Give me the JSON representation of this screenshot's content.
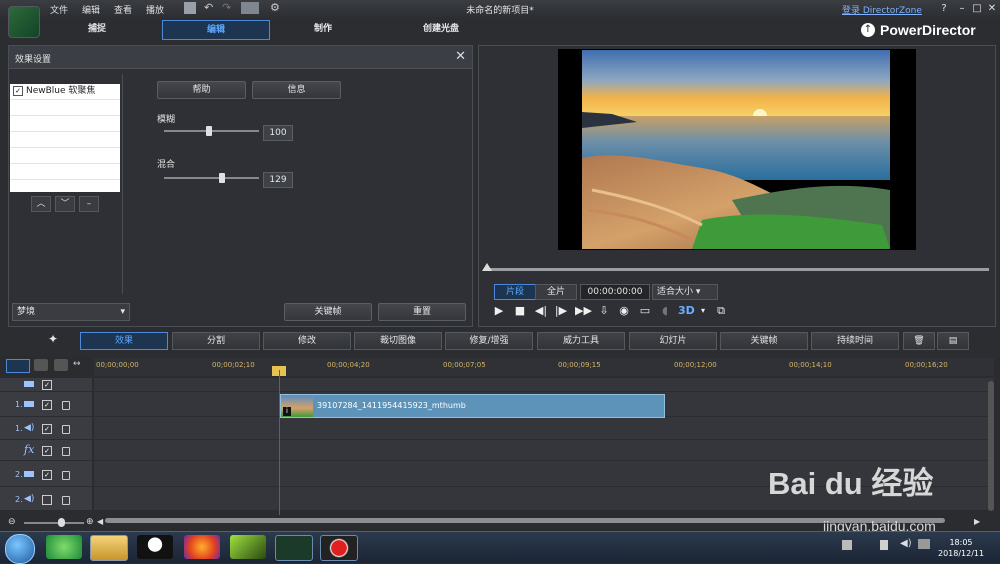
{
  "menu": [
    "文件",
    "编辑",
    "查看",
    "播放"
  ],
  "title": "未命名的新项目*",
  "login": "登录 DirectorZone",
  "modes": [
    "捕捉",
    "编辑",
    "制作",
    "创建光盘"
  ],
  "active_mode": "编辑",
  "brand": "PowerDirector",
  "effect_panel": {
    "title": "效果设置",
    "list_item": "NewBlue 软聚焦",
    "help_label": "帮助",
    "info_label": "信息",
    "blur_label": "模糊",
    "blur_value": "100",
    "mix_label": "混合",
    "mix_value": "129",
    "preset": "梦境",
    "keyframe_label": "关键帧",
    "reset_label": "重置"
  },
  "preview": {
    "segment_label": "片段",
    "full_label": "全片",
    "timecode": "00:00:00:00",
    "fit_label": "适合大小"
  },
  "toolbar": [
    "效果",
    "分割",
    "修改",
    "裁切图像",
    "修复/增强",
    "威力工具",
    "幻灯片",
    "关键帧",
    "持续时间"
  ],
  "timeline": {
    "ticks": [
      "00;00;00;00",
      "00;00;02;10",
      "00;00;04;20",
      "00;00;07;05",
      "00;00;09;15",
      "00;00;12;00",
      "00;00;14;10",
      "00;00;16;20"
    ],
    "clip_name": "39107284_1411954415923_mthumb",
    "track_numbers": [
      "1.",
      "1.",
      "2.",
      "2."
    ]
  },
  "taskbar": {
    "time": "18:05",
    "date": "2018/12/11"
  },
  "watermark": {
    "brand": "Bai du 经验",
    "url": "jingyan.baidu.com"
  }
}
